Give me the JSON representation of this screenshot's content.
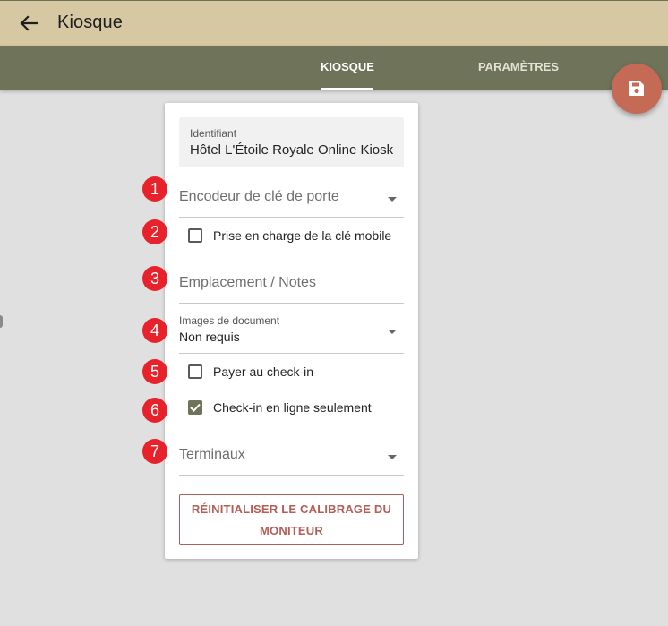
{
  "appbar": {
    "title": "Kiosque",
    "back_icon": "arrow-left-icon"
  },
  "tabs": [
    {
      "label": "KIOSQUE",
      "active": true
    },
    {
      "label": "PARAMÈTRES",
      "active": false
    }
  ],
  "fab": {
    "icon": "floppy-disk-icon",
    "color": "#c46a55"
  },
  "form": {
    "identifier": {
      "label": "Identifiant",
      "value": "Hôtel L'Étoile Royale Online Kiosk"
    },
    "door_key_encoder": {
      "placeholder": "Encodeur de clé de porte"
    },
    "mobile_key": {
      "label": "Prise en charge de la clé mobile",
      "checked": false
    },
    "location_notes": {
      "placeholder": "Emplacement / Notes"
    },
    "document_images": {
      "label": "Images de document",
      "value": "Non requis"
    },
    "pay_at_checkin": {
      "label": "Payer au check-in",
      "checked": false
    },
    "online_checkin_only": {
      "label": "Check-in en ligne seulement",
      "checked": true
    },
    "terminals": {
      "placeholder": "Terminaux"
    },
    "reset_button": {
      "line1": "RÉINITIALISER LE CALIBRAGE DU",
      "line2": "MONITEUR"
    }
  },
  "badges": [
    "1",
    "2",
    "3",
    "4",
    "5",
    "6",
    "7"
  ],
  "colors": {
    "appbar": "#d5c8a2",
    "tabbar": "#6e735a",
    "background": "#e0e0e0",
    "badge": "#e8222a",
    "reset_button": "#b35e56"
  }
}
